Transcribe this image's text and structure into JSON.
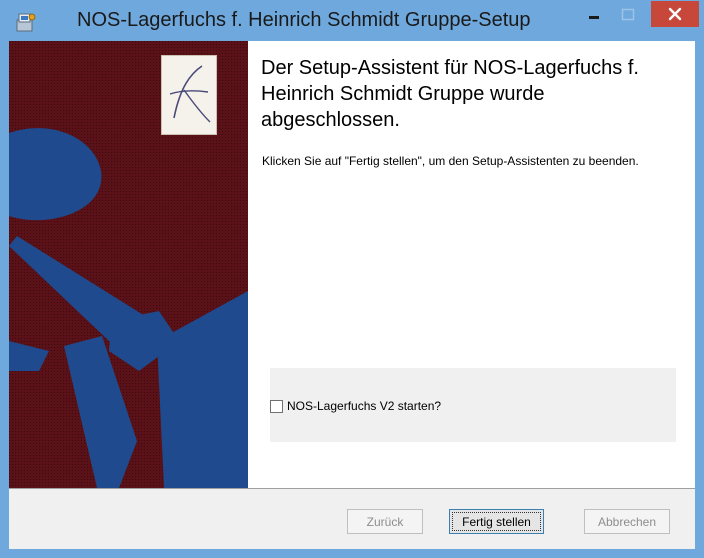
{
  "window": {
    "title": "NOS-Lagerfuchs f. Heinrich Schmidt Gruppe-Setup",
    "icon": "installer-icon",
    "controls": {
      "minimize_icon": "minimize-icon",
      "maximize_icon": "maximize-icon",
      "close_icon": "close-icon",
      "close_color": "#c7473b"
    },
    "frame_color": "#6fa8dc"
  },
  "banner": {
    "logo_icon": "lagerfuchs-logo-icon",
    "background_color": "#5a1218",
    "anchor_color": "#1f4a8e"
  },
  "content": {
    "heading": "Der Setup-Assistent für NOS-Lagerfuchs f. Heinrich Schmidt Gruppe wurde abgeschlossen.",
    "description": "Klicken Sie auf \"Fertig stellen\", um den Setup-Assistenten zu beenden."
  },
  "option": {
    "checkbox_label": "NOS-Lagerfuchs V2 starten?",
    "checked": false
  },
  "footer": {
    "back_label": "Zurück",
    "finish_label": "Fertig stellen",
    "cancel_label": "Abbrechen"
  }
}
